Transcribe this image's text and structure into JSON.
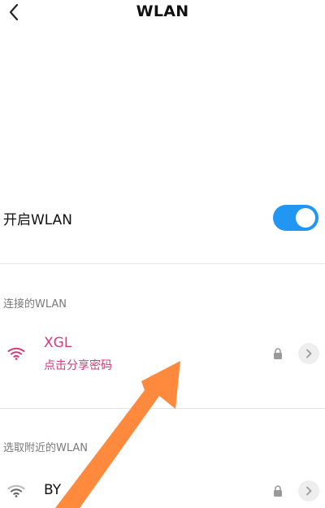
{
  "header": {
    "title": "WLAN",
    "back_icon": "chevron-left-icon"
  },
  "toggle": {
    "label": "开启WLAN",
    "enabled": true,
    "on_color": "#2196f3"
  },
  "sections": {
    "connected_header": "连接的WLAN",
    "nearby_header": "选取附近的WLAN"
  },
  "connected_network": {
    "ssid": "XGL",
    "hint": "点击分享密码",
    "accent_color": "#d63a7b",
    "icons": [
      "wifi-icon",
      "lock-icon",
      "chevron-right-icon"
    ]
  },
  "nearby_networks": [
    {
      "ssid": "BY",
      "icons": [
        "wifi-icon",
        "lock-icon",
        "chevron-right-icon"
      ]
    }
  ],
  "annotation": {
    "type": "arrow",
    "color": "#ff8a3d",
    "points_to": "点击分享密码"
  }
}
